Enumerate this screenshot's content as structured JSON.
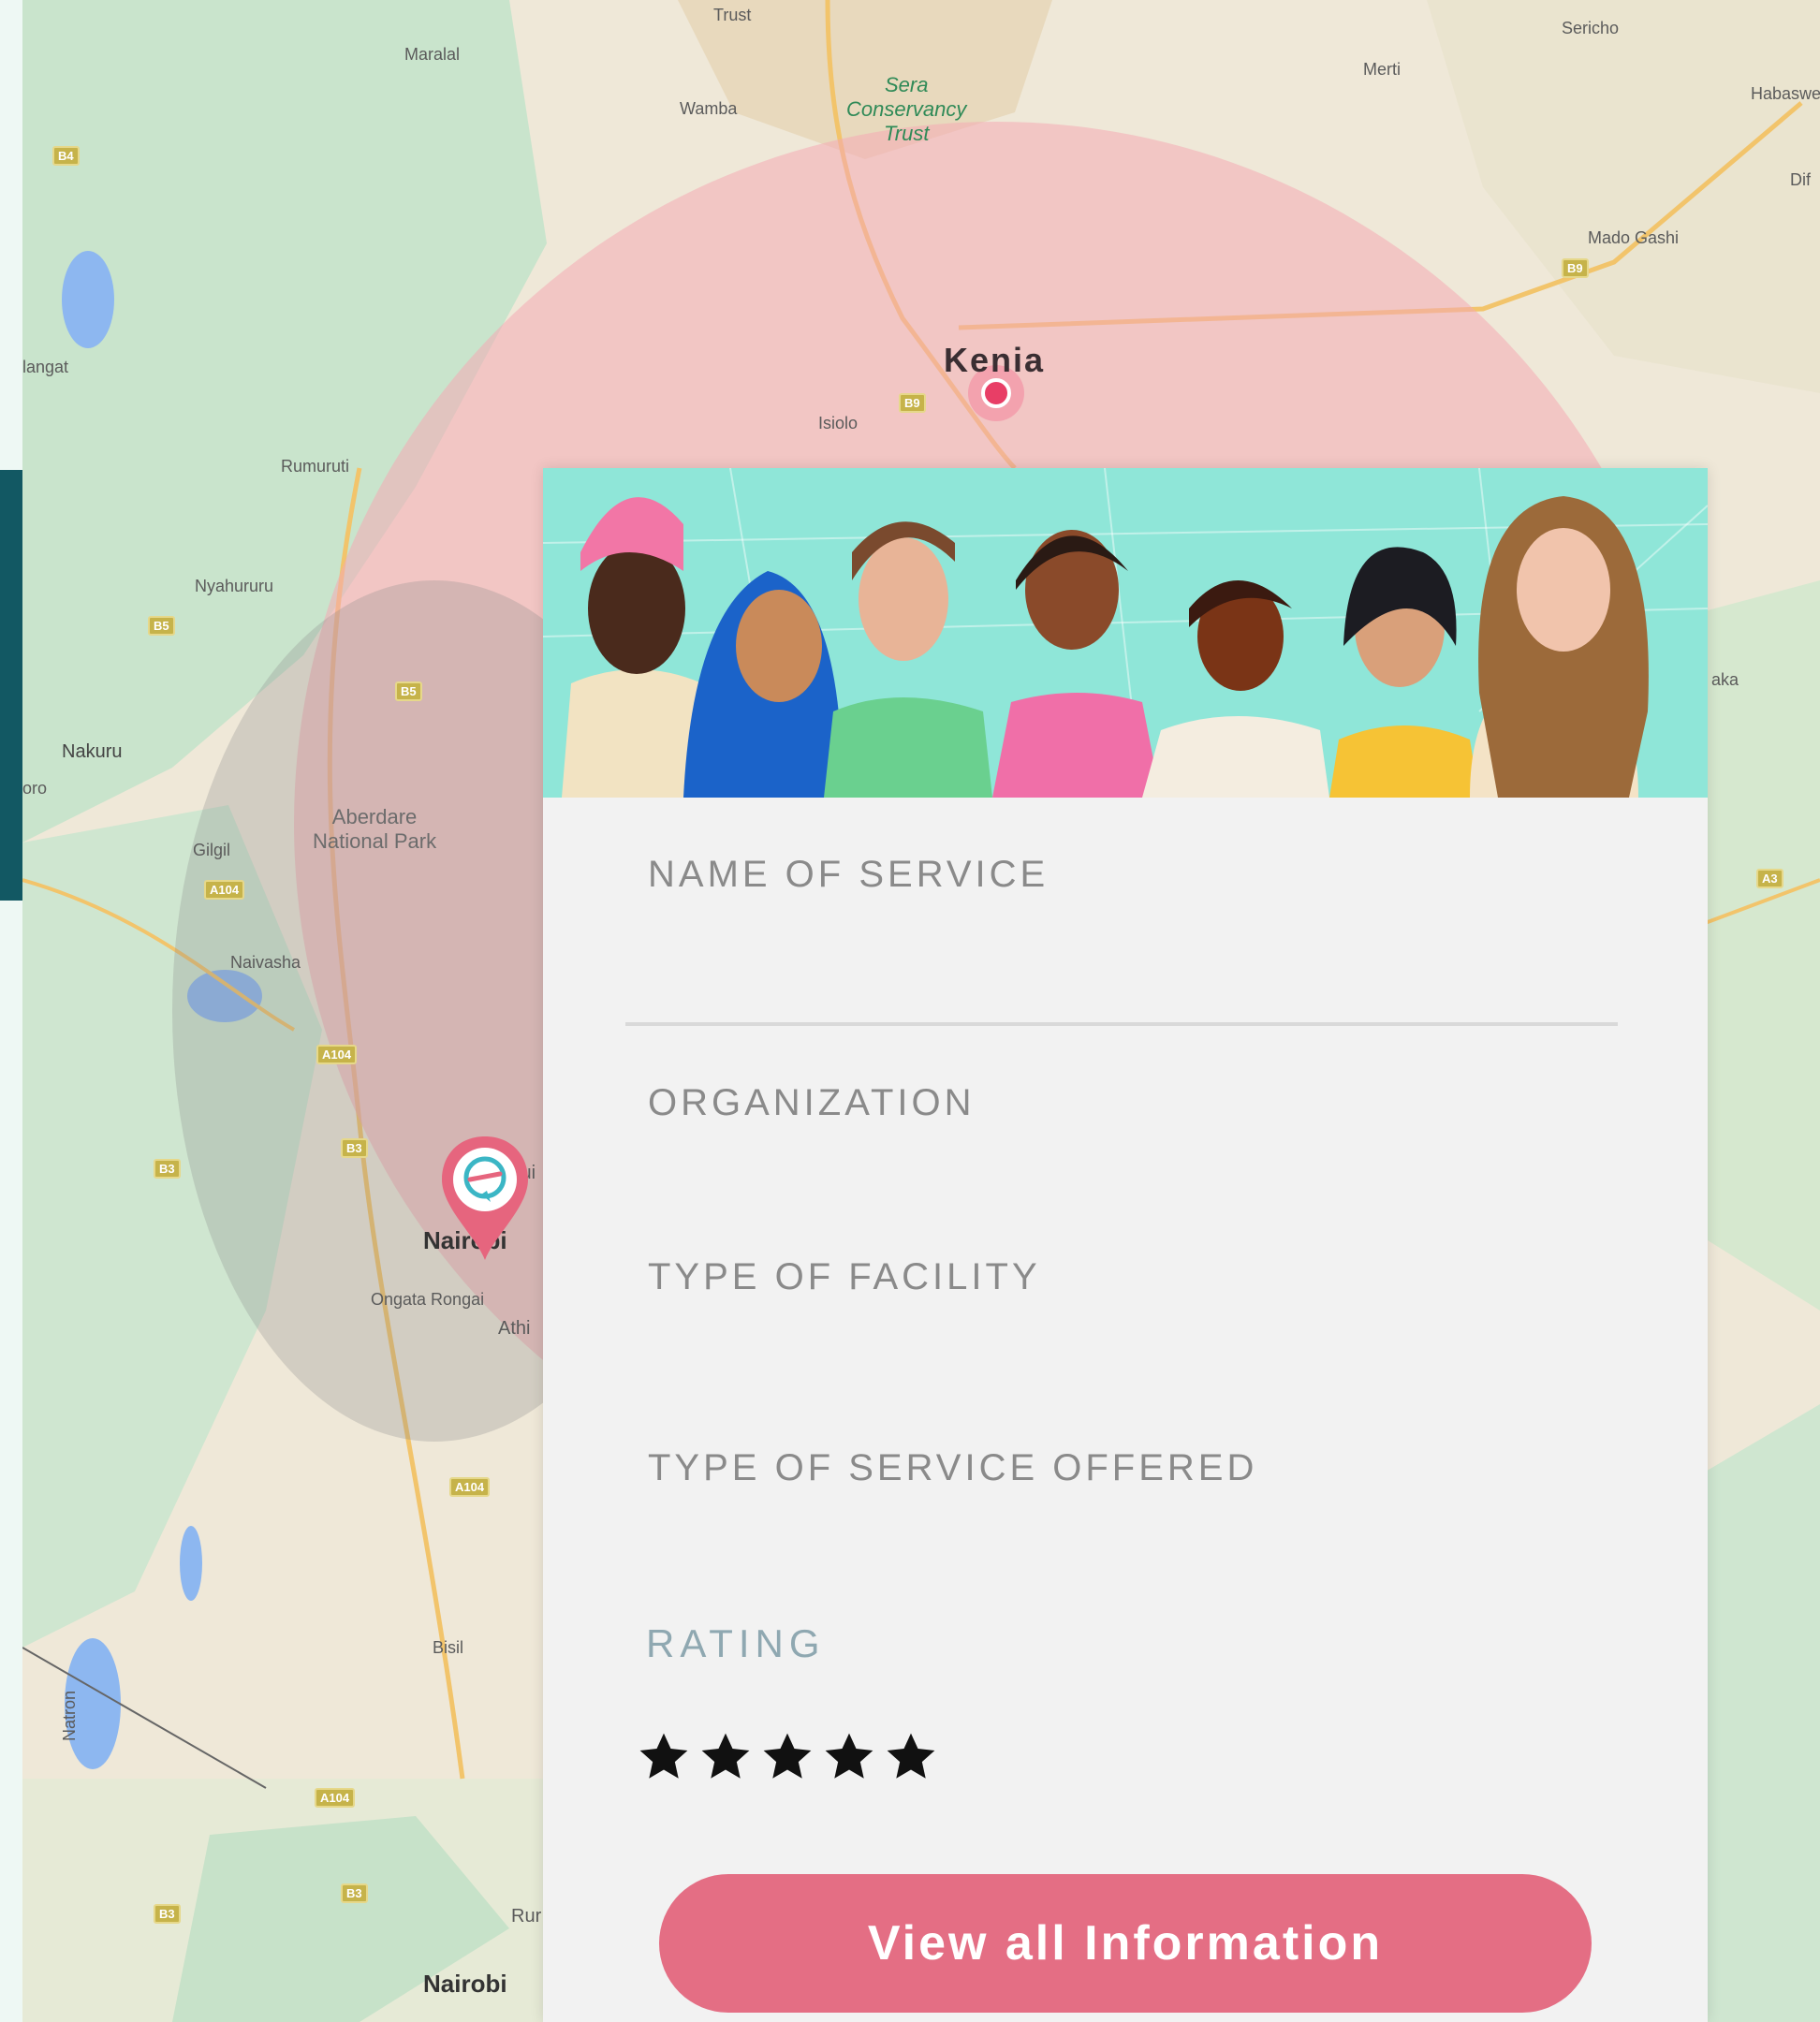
{
  "map": {
    "places": {
      "trust_top": "Trust",
      "sera": "Sera\nConservancy\nTrust",
      "maralal": "Maralal",
      "wamba": "Wamba",
      "merti": "Merti",
      "sericho": "Sericho",
      "habaswein": "Habaswe",
      "dif": "Dif",
      "mado_gashi": "Mado Gashi",
      "kenia": "Kenia",
      "isiolo": "Isiolo",
      "rumuruti": "Rumuruti",
      "nyahururu": "Nyahururu",
      "nakuru": "Nakuru",
      "njoro": "oro",
      "gilgil": "Gilgil",
      "aberdare": "Aberdare\nNational Park",
      "naivasha": "Naivasha",
      "nairobi": "Nairobi",
      "ongata_rongai": "Ongata Rongai",
      "athi": "Athi",
      "ruiru": "Rui",
      "ruiru_lower": "Rur",
      "bisil": "Bisil",
      "natron": "Natron",
      "lanigat": "langat",
      "nairobi_lower": "Nairobi",
      "saka": "aka"
    },
    "road_shields": [
      "B4",
      "B9",
      "B9",
      "B5",
      "B5",
      "A104",
      "A104",
      "A104",
      "B3",
      "B3",
      "A104",
      "A3",
      "B4",
      "B3",
      "B3",
      "A104"
    ]
  },
  "card": {
    "fields": {
      "name_of_service": "NAME OF SERVICE",
      "organization": "ORGANIZATION",
      "type_of_facility": "TYPE OF FACILITY",
      "type_of_service_offered": "TYPE OF SERVICE OFFERED"
    },
    "rating": {
      "label": "RATING",
      "value": 5,
      "max": 5
    },
    "cta_label": "View all Information"
  },
  "colors": {
    "accent": "#e46e84",
    "side_tab": "#125863",
    "hero_bg": "#8fe6d8",
    "radius_overlay": "#f4a9b5"
  },
  "icons": {
    "map_pin": "location-pin-icon",
    "star": "star-icon"
  }
}
